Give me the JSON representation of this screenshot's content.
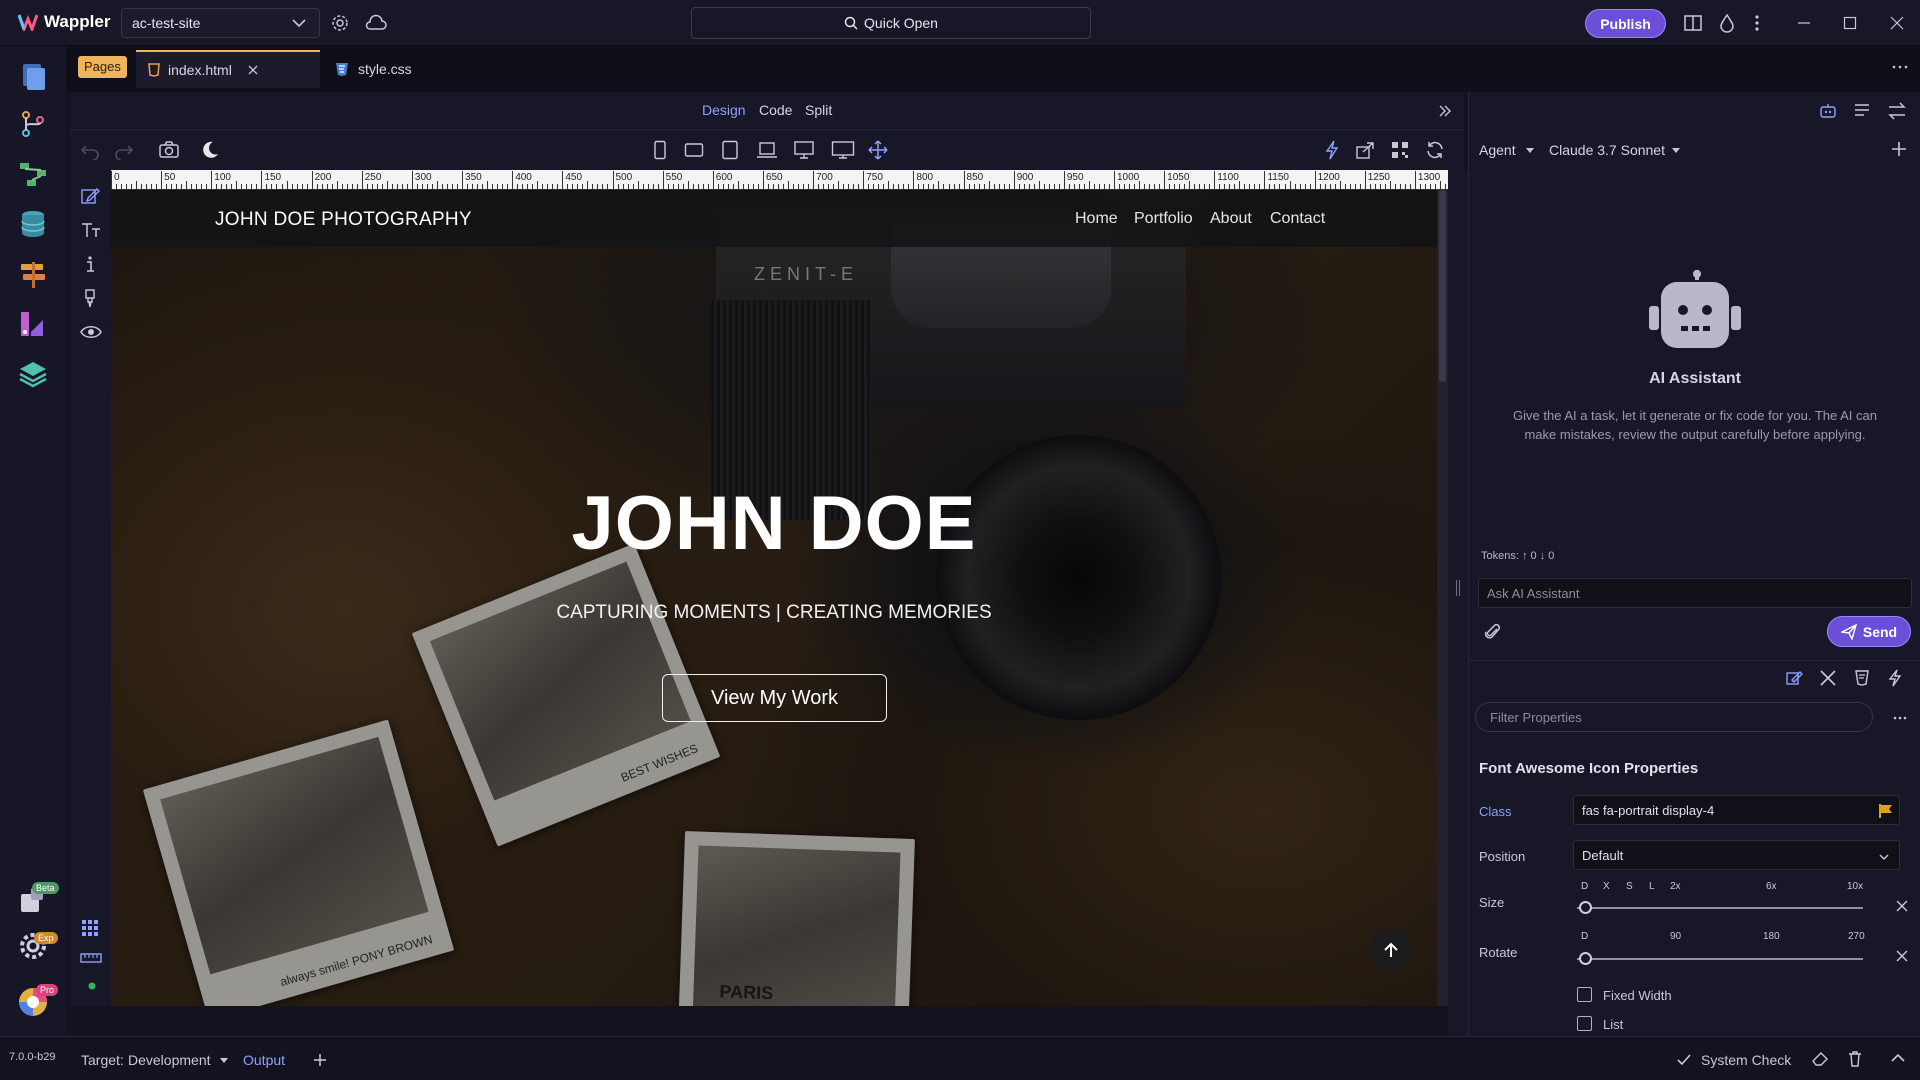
{
  "app": {
    "name": "Wappler",
    "version": "7.0.0-b29"
  },
  "titlebar": {
    "site": "ac-test-site",
    "quick_open": "Quick Open",
    "publish": "Publish"
  },
  "activity": {
    "beta_badge": "Beta",
    "exp_badge": "Exp",
    "pro_badge": "Pro"
  },
  "tabs": {
    "pages_badge": "Pages",
    "items": [
      {
        "label": "index.html",
        "icon": "html5-icon"
      },
      {
        "label": "style.css",
        "icon": "css3-icon"
      }
    ]
  },
  "modes": {
    "design": "Design",
    "code": "Code",
    "split": "Split",
    "active": "Design"
  },
  "ruler": {
    "labels": [
      "0",
      "50",
      "100",
      "150",
      "200",
      "250",
      "300",
      "350",
      "400",
      "450",
      "500",
      "550",
      "600",
      "650",
      "700",
      "750",
      "800",
      "850",
      "900",
      "950",
      "1000",
      "1050",
      "1100",
      "1150",
      "1200",
      "1250",
      "1300"
    ]
  },
  "site": {
    "brand": "JOHN DOE PHOTOGRAPHY",
    "nav": [
      "Home",
      "Portfolio",
      "About",
      "Contact"
    ],
    "hero_title": "JOHN DOE",
    "hero_subtitle": "CAPTURING MOMENTS | CREATING MEMORIES",
    "hero_button": "View My Work",
    "camera_label": "ZENIT-E",
    "photo1_caption": "BEST WISHES",
    "photo2_caption": "always smile! PONY BROWN",
    "photo3_caption": "PARIS"
  },
  "ai": {
    "mode": "Agent",
    "model": "Claude 3.7 Sonnet",
    "title": "AI Assistant",
    "description": "Give the AI a task, let it generate or fix code for you. The AI can make mistakes, review the output carefully before applying.",
    "tokens_label": "Tokens:",
    "tokens_up": "0",
    "tokens_down": "0",
    "input_placeholder": "Ask AI Assistant",
    "send": "Send"
  },
  "properties": {
    "filter_placeholder": "Filter Properties",
    "title": "Font Awesome Icon Properties",
    "class_label": "Class",
    "class_value": "fas fa-portrait display-4",
    "position_label": "Position",
    "position_value": "Default",
    "size_label": "Size",
    "size_ticks": [
      "D",
      "X",
      "S",
      "L",
      "2x",
      "6x",
      "10x"
    ],
    "rotate_label": "Rotate",
    "rotate_ticks": [
      "D",
      "90",
      "180",
      "270"
    ],
    "fixed_width": "Fixed Width",
    "list": "List"
  },
  "statusbar": {
    "target_label": "Target:",
    "target_value": "Development",
    "output": "Output",
    "system_check": "System Check"
  },
  "colors": {
    "accent": "#6b4fd8",
    "active_mode": "#8fa0ff",
    "pages_badge": "#f0b45a"
  }
}
